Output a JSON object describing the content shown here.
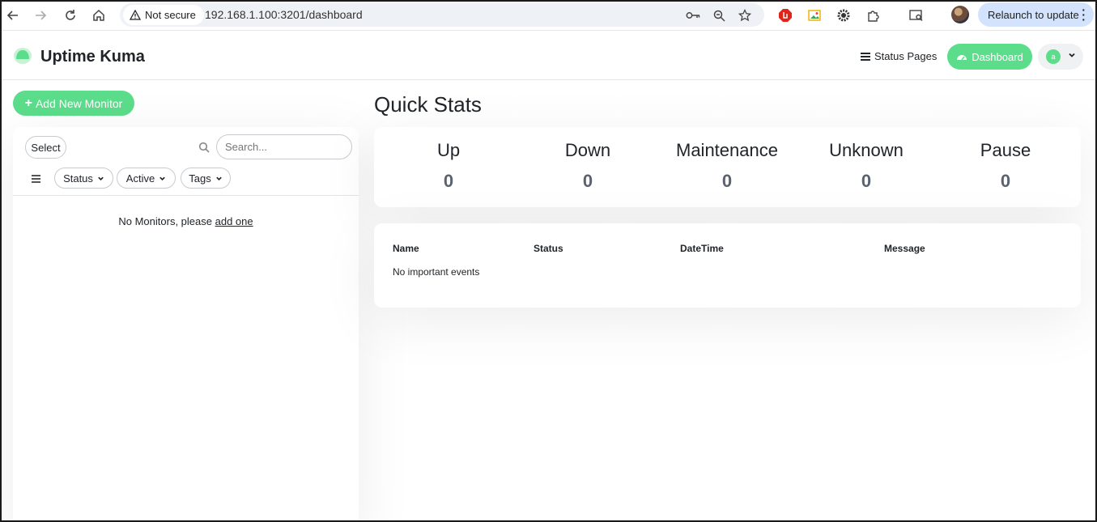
{
  "browser": {
    "security_label": "Not secure",
    "url": "192.168.1.100:3201/dashboard",
    "relaunch_label": "Relaunch to update"
  },
  "header": {
    "brand": "Uptime Kuma",
    "status_pages_label": "Status Pages",
    "dashboard_label": "Dashboard",
    "user_initial": "a",
    "accent_color": "#5cdd8b"
  },
  "sidebar": {
    "add_button_label": "Add New Monitor",
    "select_label": "Select",
    "search_placeholder": "Search...",
    "filters": [
      "Status",
      "Active",
      "Tags"
    ],
    "empty_text": "No Monitors, please",
    "empty_link": "add one"
  },
  "main": {
    "title": "Quick Stats",
    "stats": [
      {
        "label": "Up",
        "value": "0"
      },
      {
        "label": "Down",
        "value": "0"
      },
      {
        "label": "Maintenance",
        "value": "0"
      },
      {
        "label": "Unknown",
        "value": "0"
      },
      {
        "label": "Pause",
        "value": "0"
      }
    ],
    "events": {
      "columns": [
        "Name",
        "Status",
        "DateTime",
        "Message"
      ],
      "empty_text": "No important events"
    }
  }
}
